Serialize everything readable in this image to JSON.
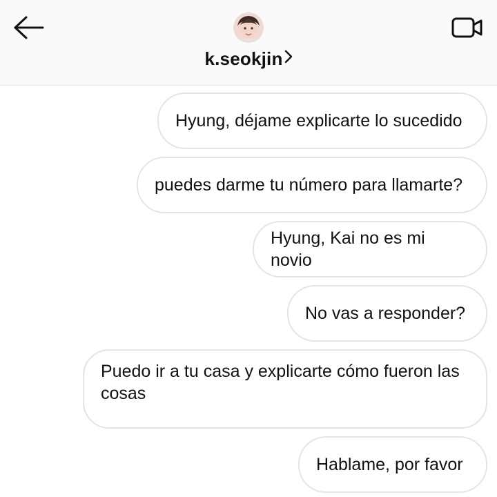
{
  "header": {
    "username": "k.seokjin"
  },
  "messages": [
    {
      "text": "Hyung, déjame explicarte lo sucedido"
    },
    {
      "text": "puedes darme tu número para llamarte?"
    },
    {
      "text": "Hyung, Kai no es mi novio"
    },
    {
      "text": "No vas a responder?"
    },
    {
      "text": "Puedo ir a tu casa y explicarte cómo fueron las cosas"
    },
    {
      "text": "Hablame, por favor"
    }
  ],
  "icons": {
    "back": "back-arrow-icon",
    "video": "video-call-icon",
    "chevron": "chevron-right-icon"
  }
}
